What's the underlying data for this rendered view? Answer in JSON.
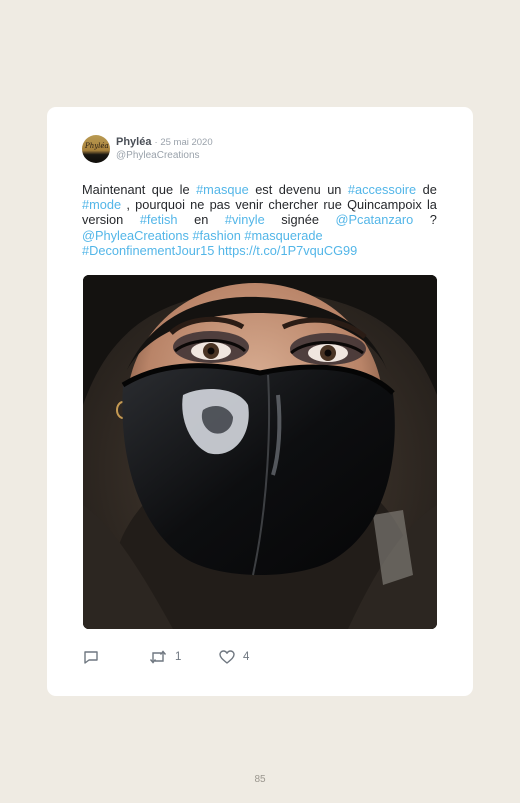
{
  "tweet": {
    "avatar_text": "Phyléa",
    "author_name": "Phyléa",
    "date": "· 25 mai 2020",
    "handle": "@PhyleaCreations",
    "text_lines": [
      [
        {
          "t": "Maintenant que le ",
          "link": false
        },
        {
          "t": "#masque",
          "link": true
        },
        {
          "t": " est devenu un ",
          "link": false
        },
        {
          "t": "#accessoire",
          "link": true
        },
        {
          "t": " de",
          "link": false
        }
      ],
      [
        {
          "t": "#mode",
          "link": true
        },
        {
          "t": ", pourquoi ne pas venir chercher rue Quincampoix la",
          "link": false
        }
      ],
      [
        {
          "t": "version ",
          "link": false
        },
        {
          "t": "#fetish",
          "link": true
        },
        {
          "t": " en ",
          "link": false
        },
        {
          "t": "#vinyle",
          "link": true
        },
        {
          "t": " signée ",
          "link": false
        },
        {
          "t": "@Pcatanzaro",
          "link": true
        },
        {
          "t": " ?",
          "link": false
        }
      ],
      [
        {
          "t": "@PhyleaCreations #fashion #masquerade",
          "link": true
        }
      ],
      [
        {
          "t": "#DeconfinementJour15 https://t.co/1P7vquCG99",
          "link": true
        }
      ]
    ],
    "retweet_count": "1",
    "like_count": "4"
  },
  "page": {
    "number": "85"
  },
  "colors": {
    "page_background": "#efebe3",
    "card_background": "#ffffff",
    "link": "#53b6e8",
    "text": "#26282c",
    "muted": "#9aa2ab"
  },
  "icons": {
    "reply": "speech-bubble",
    "retweet": "retweet-arrows",
    "like": "heart"
  }
}
